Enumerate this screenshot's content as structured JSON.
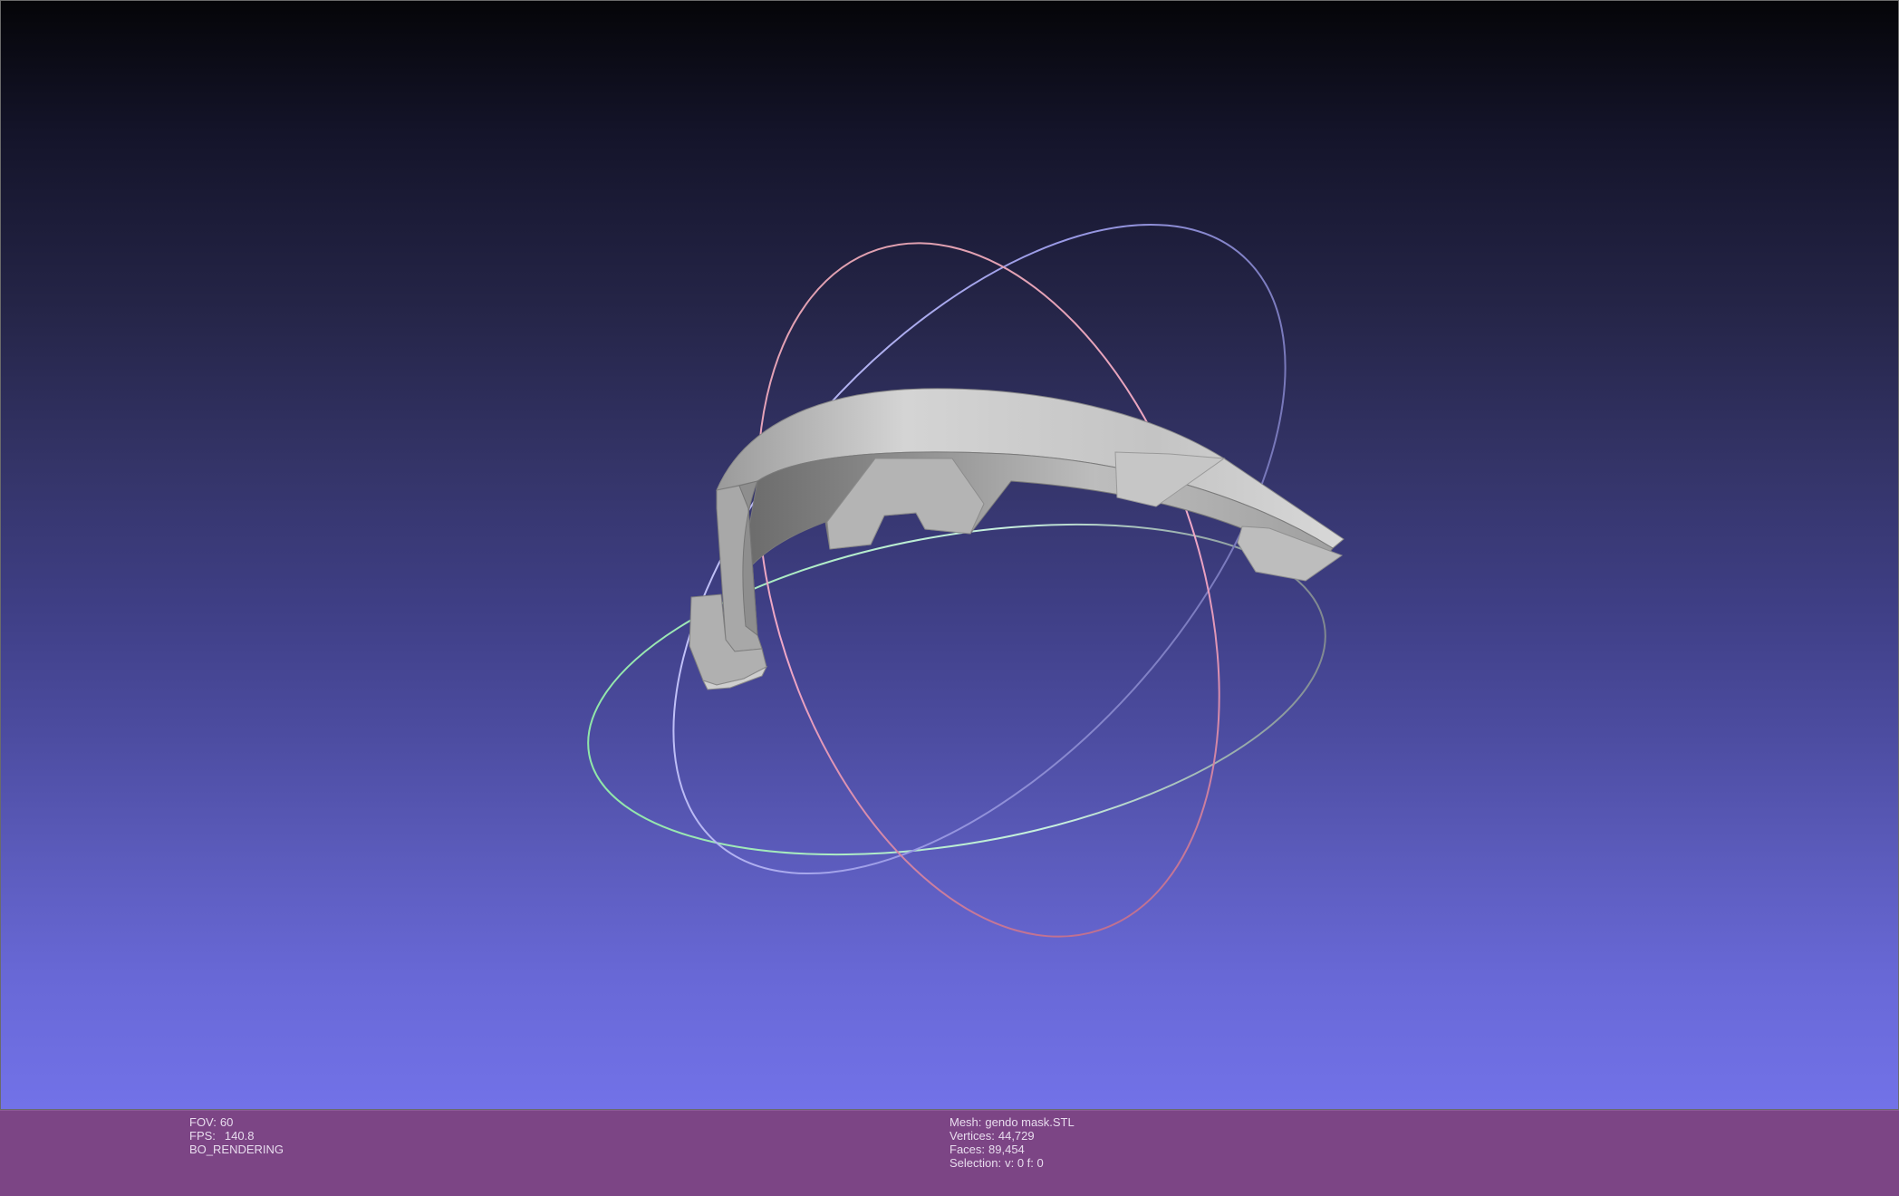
{
  "viewport": {
    "name": "3d-mesh-viewer",
    "background_gradient": [
      "#050508",
      "#7272e8"
    ],
    "trackball_colors": {
      "x_ring": "#a8a8f0",
      "y_ring": "#8be0a8",
      "z_ring": "#f0a8c8",
      "neutral_ring": "#888890"
    },
    "mesh_color": "#c8c8c8"
  },
  "info_left": {
    "fov_label": "FOV:",
    "fov_value": "60",
    "fps_label": "FPS:",
    "fps_value": "140.8",
    "render_mode": "BO_RENDERING"
  },
  "info_right": {
    "mesh_label": "Mesh:",
    "mesh_value": "gendo mask.STL",
    "vertices_label": "Vertices:",
    "vertices_value": "44,729",
    "faces_label": "Faces:",
    "faces_value": "89,454",
    "selection_label": "Selection:",
    "selection_value": "v: 0 f: 0"
  },
  "info_bar_color": "#7c4585"
}
